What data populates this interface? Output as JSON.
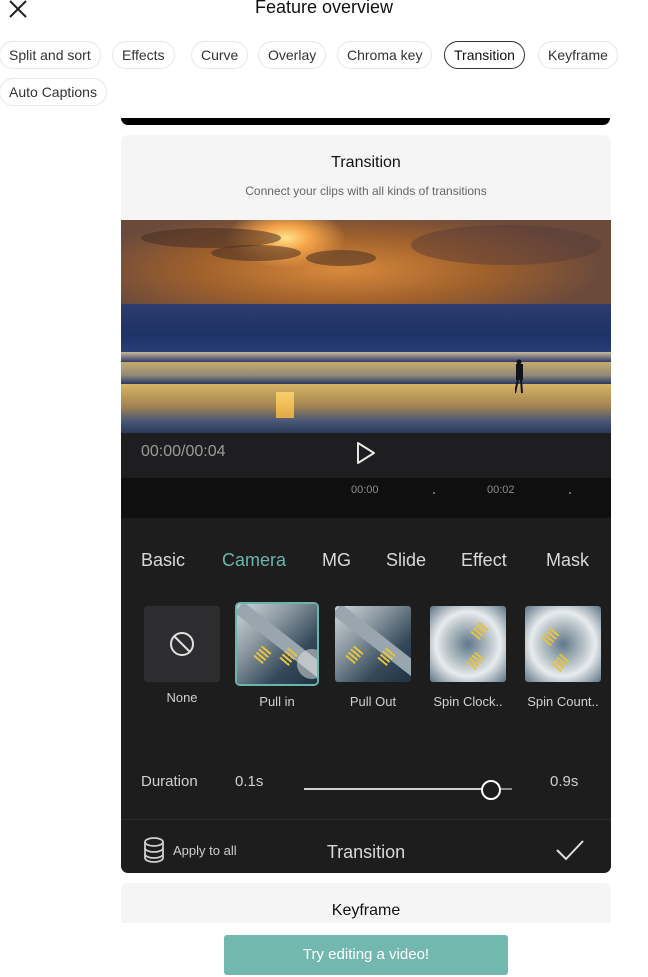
{
  "header": {
    "title": "Feature overview",
    "close_icon": "close-icon"
  },
  "chips": [
    {
      "label": "Split and sort",
      "active": false
    },
    {
      "label": "Effects",
      "active": false
    },
    {
      "label": "Curve",
      "active": false
    },
    {
      "label": "Overlay",
      "active": false
    },
    {
      "label": "Chroma key",
      "active": false
    },
    {
      "label": "Transition",
      "active": true
    },
    {
      "label": "Keyframe",
      "active": false
    },
    {
      "label": "Auto Captions",
      "active": false
    }
  ],
  "card": {
    "title": "Transition",
    "subtitle": "Connect your clips with all kinds of transitions",
    "player": {
      "time": "00:00/00:04",
      "play_icon": "play-icon",
      "ruler": [
        "00:00",
        "00:02"
      ]
    },
    "tabs": [
      {
        "label": "Basic",
        "active": false
      },
      {
        "label": "Camera",
        "active": true
      },
      {
        "label": "MG",
        "active": false
      },
      {
        "label": "Slide",
        "active": false
      },
      {
        "label": "Effect",
        "active": false
      },
      {
        "label": "Mask",
        "active": false
      }
    ],
    "transitions": [
      {
        "label": "None",
        "icon": "none-icon",
        "selected": false
      },
      {
        "label": "Pull in",
        "selected": true
      },
      {
        "label": "Pull Out",
        "selected": false
      },
      {
        "label": "Spin Clock..",
        "selected": false
      },
      {
        "label": "Spin Count..",
        "selected": false
      }
    ],
    "duration": {
      "label": "Duration",
      "min": "0.1s",
      "max": "0.9s",
      "value_fraction": 0.9
    },
    "footer": {
      "apply_all": "Apply to all",
      "title": "Transition",
      "confirm_icon": "check-icon"
    }
  },
  "next_card": {
    "title": "Keyframe"
  },
  "cta": {
    "label": "Try editing a video!"
  },
  "colors": {
    "accent": "#6bb6aa",
    "cta": "#72b8ae"
  }
}
